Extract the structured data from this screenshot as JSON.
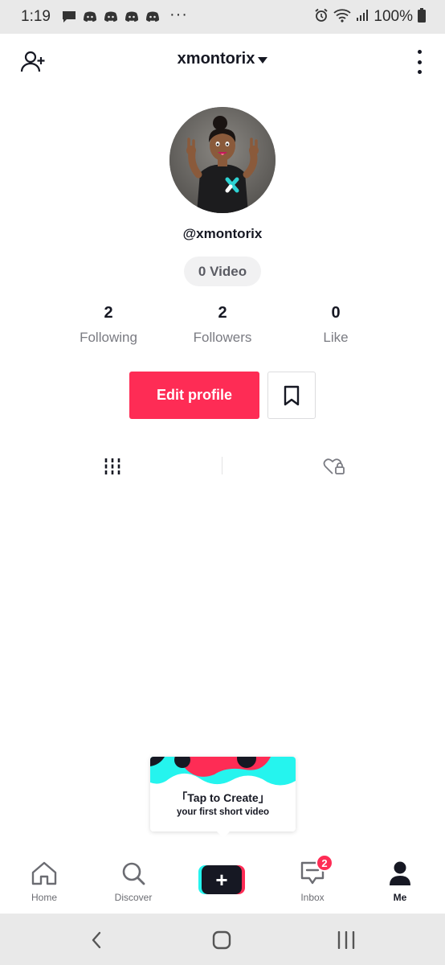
{
  "status_bar": {
    "time": "1:19",
    "notifications": [
      "message-icon",
      "discord-icon",
      "discord-icon",
      "discord-icon",
      "discord-icon"
    ],
    "more": "···",
    "battery": "100%"
  },
  "header": {
    "username": "xmontorix"
  },
  "profile": {
    "handle": "@xmontorix",
    "video_count": "0 Video",
    "stats": [
      {
        "value": "2",
        "label": "Following"
      },
      {
        "value": "2",
        "label": "Followers"
      },
      {
        "value": "0",
        "label": "Like"
      }
    ],
    "edit_label": "Edit profile"
  },
  "tooltip": {
    "title": "「Tap to Create」",
    "subtitle": "your first short video"
  },
  "bottom_nav": {
    "items": [
      {
        "label": "Home",
        "icon": "home-icon"
      },
      {
        "label": "Discover",
        "icon": "search-icon"
      },
      {
        "label": "Inbox",
        "icon": "inbox-icon",
        "badge": "2"
      },
      {
        "label": "Me",
        "icon": "profile-icon"
      }
    ],
    "create_icon": "+"
  },
  "colors": {
    "accent": "#fe2c55",
    "cyan": "#25f4ee",
    "text": "#161823",
    "muted": "#7a7b82"
  }
}
